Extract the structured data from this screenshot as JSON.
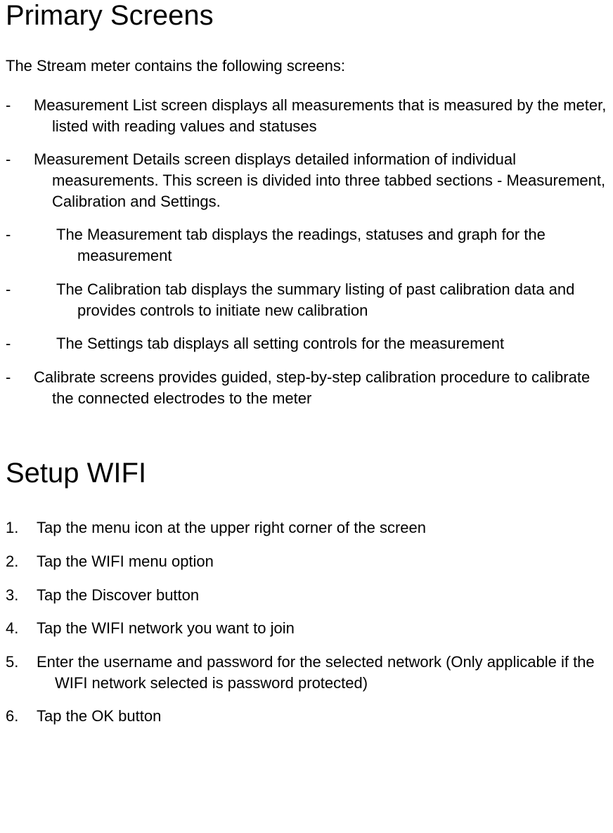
{
  "section1": {
    "heading": "Primary Screens",
    "intro": "The Stream meter contains the following screens:",
    "items": [
      {
        "level": 1,
        "text": "Measurement List screen displays all measurements that is measured by the meter, listed with reading values and statuses"
      },
      {
        "level": 1,
        "text": "Measurement Details screen displays detailed information of individual measurements. This screen is divided into three tabbed sections - Measurement, Calibration and Settings."
      },
      {
        "level": 2,
        "text": "The Measurement tab displays the readings, statuses and graph for the measurement"
      },
      {
        "level": 2,
        "text": "The Calibration tab displays the summary listing of past calibration data and provides controls to initiate new calibration"
      },
      {
        "level": 2,
        "text": "The Settings tab displays all setting controls for the measurement"
      },
      {
        "level": 1,
        "text": "Calibrate screens provides guided, step-by-step calibration procedure to calibrate the connected electrodes to the meter"
      }
    ]
  },
  "section2": {
    "heading": "Setup WIFI",
    "steps": [
      {
        "num": "1.",
        "text": "Tap the menu icon at the upper right corner of the screen"
      },
      {
        "num": "2.",
        "text": "Tap the WIFI menu option"
      },
      {
        "num": "3.",
        "text": "Tap the Discover button"
      },
      {
        "num": "4.",
        "text": "Tap the WIFI network you want to join"
      },
      {
        "num": "5.",
        "text": "Enter the username and password for the selected network (Only applicable if the WIFI network selected is password protected)"
      },
      {
        "num": "6.",
        "text": "Tap the OK button"
      }
    ]
  }
}
